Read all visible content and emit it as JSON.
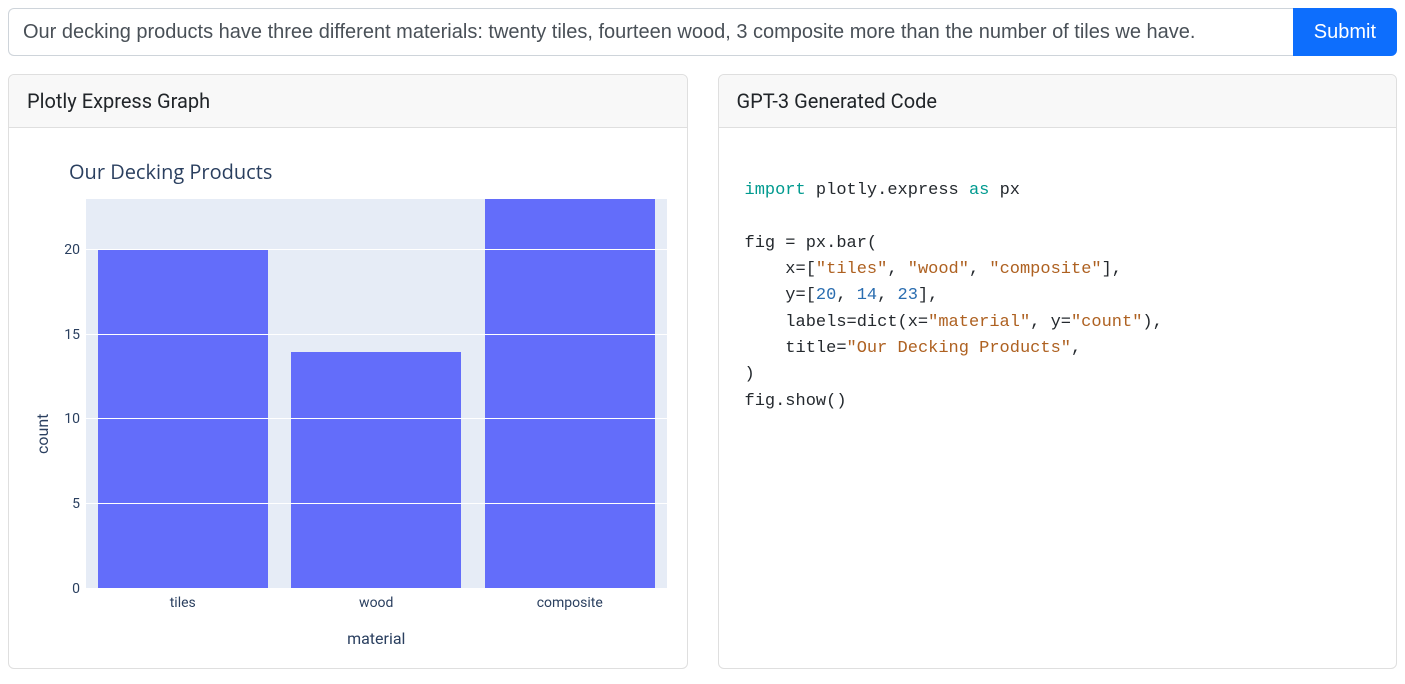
{
  "input": {
    "value": "Our decking products have three different materials: twenty tiles, fourteen wood, 3 composite more than the number of tiles we have.",
    "submit_label": "Submit"
  },
  "panels": {
    "left_title": "Plotly Express Graph",
    "right_title": "GPT-3 Generated Code"
  },
  "chart_data": {
    "type": "bar",
    "title": "Our Decking Products",
    "xlabel": "material",
    "ylabel": "count",
    "categories": [
      "tiles",
      "wood",
      "composite"
    ],
    "values": [
      20,
      14,
      23
    ],
    "y_ticks": [
      0,
      5,
      10,
      15,
      20
    ],
    "ylim": [
      0,
      23
    ],
    "bar_color": "#636dfa",
    "plot_bg": "#e6ecf6"
  },
  "code": {
    "kw_import": "import",
    "mod": "plotly.express",
    "kw_as": "as",
    "alias": "px",
    "assign_lhs": "fig = px.bar(",
    "x_prefix": "    x=[",
    "x_val1": "\"tiles\"",
    "x_val2": "\"wood\"",
    "x_val3": "\"composite\"",
    "x_suffix": "],",
    "y_prefix": "    y=[",
    "y_val1": "20",
    "y_val2": "14",
    "y_val3": "23",
    "y_suffix": "],",
    "labels_prefix": "    labels=dict(x=",
    "labels_xval": "\"material\"",
    "labels_mid": ", y=",
    "labels_yval": "\"count\"",
    "labels_suffix": "),",
    "title_prefix": "    title=",
    "title_val": "\"Our Decking Products\"",
    "title_suffix": ",",
    "close_paren": ")",
    "show": "fig.show()"
  }
}
